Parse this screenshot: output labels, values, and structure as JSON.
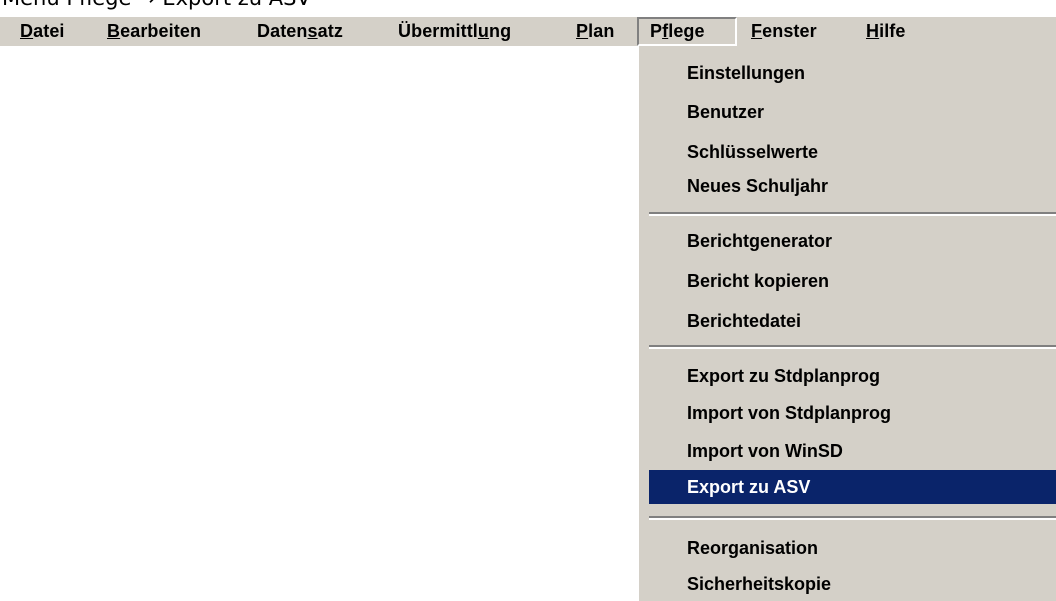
{
  "caption": "Menü Pflege → Export zu ASV",
  "menubar": {
    "items": [
      {
        "pre": "",
        "acc": "D",
        "post": "atei"
      },
      {
        "pre": "",
        "acc": "B",
        "post": "earbeiten"
      },
      {
        "pre": "Daten",
        "acc": "s",
        "post": "atz"
      },
      {
        "pre": "Übermittl",
        "acc": "u",
        "post": "ng"
      },
      {
        "pre": "",
        "acc": "P",
        "post": "lan"
      },
      {
        "pre": "P",
        "acc": "f",
        "post": "lege"
      },
      {
        "pre": "",
        "acc": "F",
        "post": "enster"
      },
      {
        "pre": "",
        "acc": "H",
        "post": "ilfe"
      }
    ]
  },
  "dropdown": {
    "groups": [
      [
        "Einstellungen",
        "Benutzer",
        "Schlüsselwerte",
        "Neues Schuljahr"
      ],
      [
        "Berichtgenerator",
        "Bericht kopieren",
        "Berichtedatei"
      ],
      [
        "Export zu Stdplanprog",
        "Import von Stdplanprog",
        "Import von WinSD",
        "Export zu ASV"
      ],
      [
        "Reorganisation",
        "Sicherheitskopie"
      ]
    ],
    "highlighted": "Export zu ASV",
    "highlight_color": "#0a246a"
  }
}
